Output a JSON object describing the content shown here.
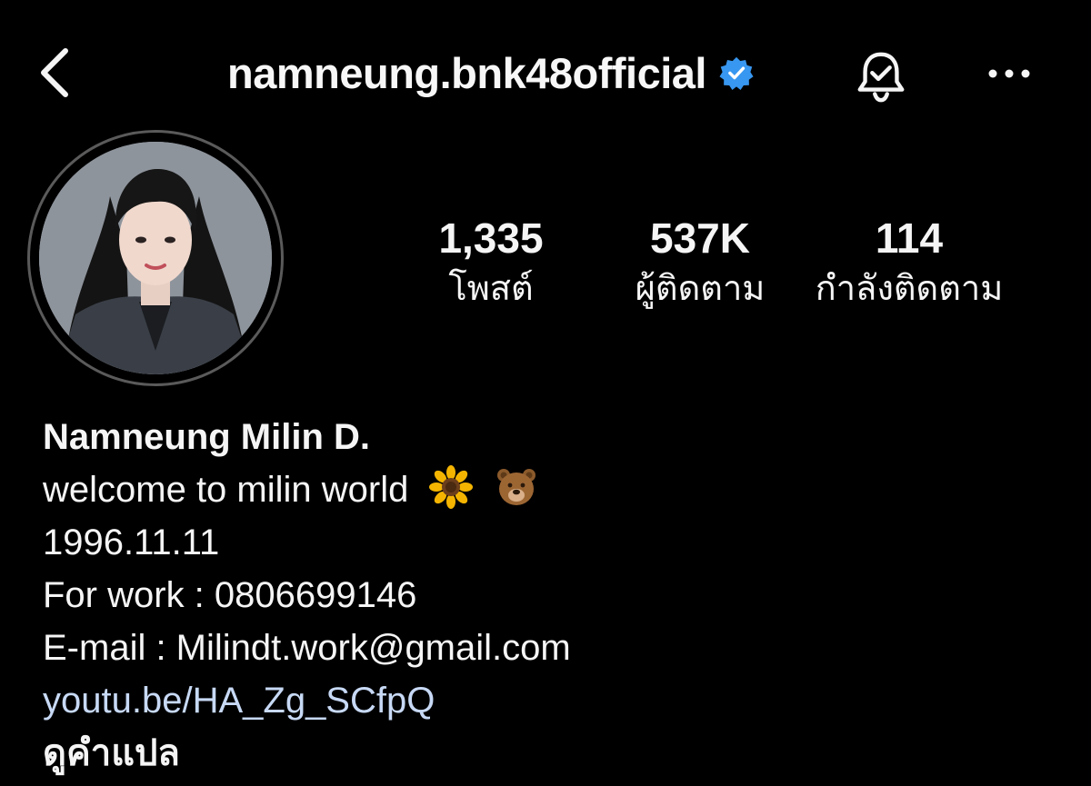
{
  "header": {
    "username": "namneung.bnk48official",
    "back_icon": "chevron-left-icon",
    "verified_icon": "verified-badge-icon",
    "bell_icon": "notification-bell-check-icon",
    "more_icon": "more-horizontal-icon",
    "verified_color": "#3897f0"
  },
  "profile": {
    "avatar_icon": "profile-avatar",
    "stats": {
      "posts": {
        "value": "1,335",
        "label": "โพสต์"
      },
      "followers": {
        "value": "537K",
        "label": "ผู้ติดตาม"
      },
      "following": {
        "value": "114",
        "label": "กำลังติดตาม"
      }
    }
  },
  "bio": {
    "name": "Namneung Milin D.",
    "line1": "welcome to milin world",
    "line1_emojis": [
      "sunflower-icon",
      "bear-face-icon"
    ],
    "line2": "1996.11.11",
    "line3": "For work : 0806699146",
    "line4": "E-mail : Milindt.work@gmail.com",
    "link": "youtu.be/HA_Zg_SCfpQ",
    "translate": "ดูคำแปล",
    "link_color": "#c7d9f5"
  }
}
